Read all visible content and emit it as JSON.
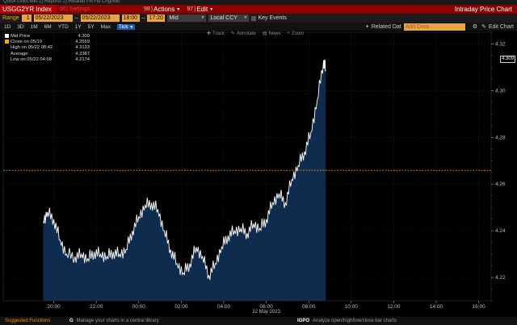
{
  "top_strip": "Quick Links     Mkt     1) Reports      2) Related      Px/Yld     Chg/Mkt",
  "titlebar": {
    "ticker": "USGG2YR Index",
    "hidden_title": "96) Settings",
    "actions_num": "98",
    "actions_label": "Actions",
    "edit_num": "97",
    "edit_label": "Edit",
    "right_title": "Intraday Price Chart"
  },
  "rangebar": {
    "range_label": "Range",
    "range_num": "1",
    "start_date": "05/22/2023",
    "end_date": "05/22/2023",
    "start_time": "18:00",
    "end_time": "17:20",
    "market": "Mid",
    "currency": "Local CCY",
    "key_events": "Key Events"
  },
  "periods": [
    "1D",
    "3D",
    "1M",
    "6M",
    "YTD",
    "1Y",
    "5Y",
    "Max"
  ],
  "tick_label": "Tick",
  "related": {
    "label": "Related Dat",
    "placeholder": "Add Data",
    "edit_chart": "Edit Chart"
  },
  "chart_tools": [
    "Track",
    "Annotate",
    "News",
    "Zoom"
  ],
  "legend": [
    {
      "name": "Mid Price",
      "value": "4.309",
      "color": "#ffffff"
    },
    {
      "name": "Close on 05/19",
      "value": "4.2659",
      "color": "#ffa500"
    },
    {
      "name": "High on 05/22 08:42",
      "value": "4.3133",
      "color": "#ffffff"
    },
    {
      "name": "Average",
      "value": "4.2387",
      "color": "#ffffff"
    },
    {
      "name": "Low on 05/22 04:58",
      "value": "4.2174",
      "color": "#ffffff"
    }
  ],
  "last_value": "4.309",
  "chart_data": {
    "type": "area",
    "title": "USGG2YR Index",
    "xlabel": "22 May 2023",
    "xticks": [
      "20:00",
      "22:00",
      "00:00",
      "02:00",
      "04:00",
      "06:00",
      "08:00",
      "10:00",
      "12:00",
      "14:00",
      "16:00"
    ],
    "yticks": [
      4.22,
      4.24,
      4.26,
      4.28,
      4.3,
      4.32
    ],
    "ylim": [
      4.21,
      4.325
    ],
    "x_hours_from_18": [
      1.5,
      1.7,
      2.0,
      2.3,
      2.6,
      3.0,
      3.3,
      3.6,
      3.9,
      4.2,
      4.5,
      4.8,
      5.1,
      5.4,
      5.7,
      6.0,
      6.3,
      6.6,
      6.9,
      7.2,
      7.5,
      7.8,
      8.1,
      8.4,
      8.7,
      9.0,
      9.3,
      9.6,
      9.9,
      10.2,
      10.5,
      10.8,
      11.1,
      11.4,
      11.7,
      12.0,
      12.3,
      12.6,
      12.9,
      13.2,
      13.5,
      13.8,
      14.1,
      14.4,
      14.7,
      14.8
    ],
    "values": [
      4.244,
      4.248,
      4.245,
      4.236,
      4.23,
      4.229,
      4.23,
      4.228,
      4.231,
      4.23,
      4.229,
      4.231,
      4.23,
      4.232,
      4.24,
      4.246,
      4.251,
      4.252,
      4.249,
      4.24,
      4.232,
      4.226,
      4.222,
      4.226,
      4.233,
      4.229,
      4.221,
      4.226,
      4.233,
      4.238,
      4.24,
      4.241,
      4.239,
      4.243,
      4.241,
      4.245,
      4.252,
      4.256,
      4.252,
      4.262,
      4.268,
      4.274,
      4.282,
      4.296,
      4.313,
      4.309
    ],
    "close_line": 4.2659,
    "colors": {
      "fill": "#0f2b4d",
      "line": "#ffffff",
      "close": "#ffa500"
    }
  },
  "footer": {
    "suggested": "Suggested Functions",
    "g_num": "G",
    "g_text": "Manage your charts in a central library",
    "igpo_num": "IGPO",
    "igpo_text": "Analyze open/high/low/close bar charts"
  }
}
